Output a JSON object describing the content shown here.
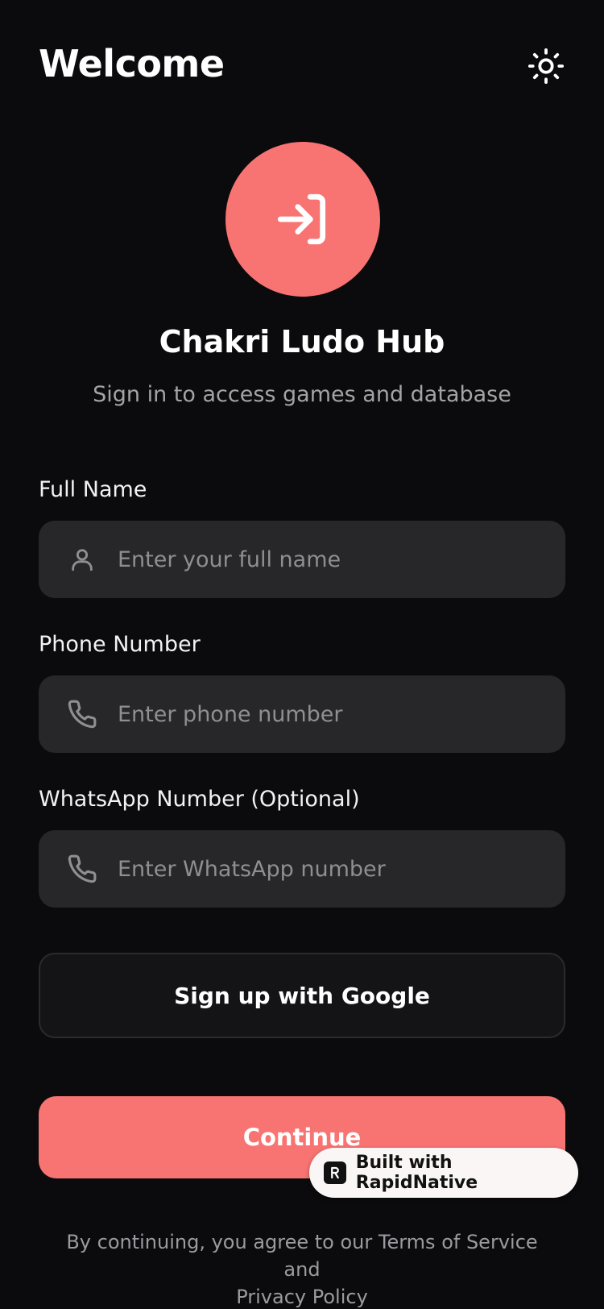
{
  "header": {
    "title": "Welcome",
    "theme_icon": "sun-icon"
  },
  "hero": {
    "icon": "login-icon",
    "app_name": "Chakri Ludo Hub",
    "subtitle": "Sign in to access games and database"
  },
  "form": {
    "full_name": {
      "label": "Full Name",
      "placeholder": "Enter your full name",
      "value": "",
      "icon": "user-icon"
    },
    "phone": {
      "label": "Phone Number",
      "placeholder": "Enter phone number",
      "value": "",
      "icon": "phone-icon"
    },
    "whatsapp": {
      "label": "WhatsApp Number (Optional)",
      "placeholder": "Enter WhatsApp number",
      "value": "",
      "icon": "phone-icon"
    }
  },
  "actions": {
    "google_label": "Sign up with Google",
    "continue_label": "Continue"
  },
  "badge": {
    "label": "Built with RapidNative",
    "icon": "rapidnative-logo-icon"
  },
  "legal": {
    "line1": "By continuing, you agree to our Terms of Service and",
    "line2": "Privacy Policy"
  },
  "colors": {
    "background": "#0b0b0d",
    "accent": "#f87472",
    "field_bg": "#27272a",
    "muted_text": "#a3a3a8"
  }
}
